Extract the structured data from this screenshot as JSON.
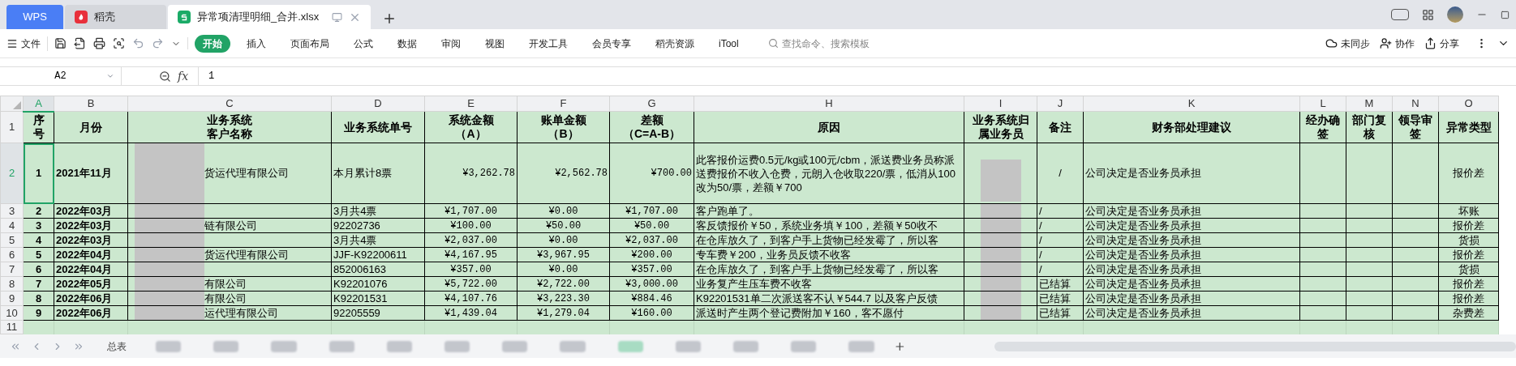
{
  "tabs": [
    {
      "label": "WPS",
      "kind": "wps",
      "selected": false
    },
    {
      "label": "稻壳",
      "kind": "docer",
      "selected": false
    },
    {
      "label": "异常项清理明细_合并.xlsx",
      "kind": "sheet",
      "selected": true
    }
  ],
  "menu": {
    "file": "文件",
    "ribbon_tabs": [
      {
        "label": "开始",
        "selected": true
      },
      {
        "label": "插入",
        "selected": false
      },
      {
        "label": "页面布局",
        "selected": false
      },
      {
        "label": "公式",
        "selected": false
      },
      {
        "label": "数据",
        "selected": false
      },
      {
        "label": "审阅",
        "selected": false
      },
      {
        "label": "视图",
        "selected": false
      },
      {
        "label": "开发工具",
        "selected": false
      },
      {
        "label": "会员专享",
        "selected": false
      },
      {
        "label": "稻壳资源",
        "selected": false
      },
      {
        "label": "iTool",
        "selected": false
      }
    ],
    "search_placeholder": "查找命令、搜索模板",
    "actions": [
      {
        "label": "未同步",
        "kind": "sync"
      },
      {
        "label": "协作",
        "kind": "collab"
      },
      {
        "label": "分享",
        "kind": "share"
      }
    ]
  },
  "formula_bar": {
    "cell": "A2",
    "fx": "fx",
    "value": "1"
  },
  "sheet": {
    "columns": [
      {
        "label": "A",
        "selected": true
      },
      {
        "label": "B",
        "selected": false
      },
      {
        "label": "C",
        "selected": false
      },
      {
        "label": "D",
        "selected": false
      },
      {
        "label": "E",
        "selected": false
      },
      {
        "label": "F",
        "selected": false
      },
      {
        "label": "G",
        "selected": false
      },
      {
        "label": "H",
        "selected": false
      },
      {
        "label": "I",
        "selected": false
      },
      {
        "label": "J",
        "selected": false
      },
      {
        "label": "K",
        "selected": false
      },
      {
        "label": "L",
        "selected": false
      },
      {
        "label": "M",
        "selected": false
      },
      {
        "label": "N",
        "selected": false
      },
      {
        "label": "O",
        "selected": false
      }
    ],
    "header_row": {
      "number": "1",
      "cells": [
        [
          "序",
          "号"
        ],
        [
          "月份"
        ],
        [
          "业务系统",
          "客户名称"
        ],
        [
          "业务系统单号"
        ],
        [
          "系统金额",
          "（A）"
        ],
        [
          "账单金额",
          "（B）"
        ],
        [
          "差额",
          "（C=A-B）"
        ],
        [
          "原因"
        ],
        [
          "业务系统归",
          "属业务员"
        ],
        [
          "备注"
        ],
        [
          "财务部处理建议"
        ],
        [
          "经办确",
          "签"
        ],
        [
          "部门复",
          "核"
        ],
        [
          "领导审",
          "签"
        ],
        [
          "异常类型"
        ]
      ]
    },
    "rows": [
      {
        "number": "2",
        "selected": true,
        "seq": "1",
        "month": "2021年11月",
        "customer": "货运代理有限公司",
        "order_no": "本月累计8票",
        "system_amount": "¥3,262.78",
        "bill_amount": "¥2,562.78",
        "difference": "¥700.00",
        "reason": "此客报价运费0.5元/kg或100元/cbm，派送费业务员称派送费报价不收入仓费，元朗入仓收取220/票，低消从100改为50/票，差额￥700",
        "remark": "/",
        "suggestion": "公司决定是否业务员承担",
        "type": "报价差"
      },
      {
        "number": "3",
        "selected": false,
        "seq": "2",
        "month": "2022年03月",
        "order_no": "3月共4票",
        "system_amount": "¥1,707.00",
        "bill_amount": "¥0.00",
        "difference": "¥1,707.00",
        "reason": "客户跑单了。",
        "remark": "/",
        "suggestion": "公司决定是否业务员承担",
        "type": "坏账"
      },
      {
        "number": "4",
        "selected": false,
        "seq": "3",
        "month": "2022年03月",
        "customer": "链有限公司",
        "order_no": "92202736",
        "system_amount": "¥100.00",
        "bill_amount": "¥50.00",
        "difference": "¥50.00",
        "reason": "客反馈报价￥50，系统业务填￥100，差额￥50收不",
        "remark": "/",
        "suggestion": "公司决定是否业务员承担",
        "type": "报价差"
      },
      {
        "number": "5",
        "selected": false,
        "seq": "4",
        "month": "2022年03月",
        "order_no": "3月共4票",
        "system_amount": "¥2,037.00",
        "bill_amount": "¥0.00",
        "difference": "¥2,037.00",
        "reason": "在仓库放久了，到客户手上货物已经发霉了，所以客",
        "remark": "/",
        "suggestion": "公司决定是否业务员承担",
        "type": "货损"
      },
      {
        "number": "6",
        "selected": false,
        "seq": "5",
        "month": "2022年04月",
        "customer": "货运代理有限公司",
        "order_no": "JJF-K92200611",
        "system_amount": "¥4,167.95",
        "bill_amount": "¥3,967.95",
        "difference": "¥200.00",
        "reason": "专车费￥200，业务员反馈不收客",
        "remark": "/",
        "suggestion": "公司决定是否业务员承担",
        "type": "报价差"
      },
      {
        "number": "7",
        "selected": false,
        "seq": "6",
        "month": "2022年04月",
        "order_no": "852006163",
        "system_amount": "¥357.00",
        "bill_amount": "¥0.00",
        "difference": "¥357.00",
        "reason": "在仓库放久了，到客户手上货物已经发霉了，所以客",
        "remark": "/",
        "suggestion": "公司决定是否业务员承担",
        "type": "货损"
      },
      {
        "number": "8",
        "selected": false,
        "seq": "7",
        "month": "2022年05月",
        "customer": "有限公司",
        "order_no": "K92201076",
        "system_amount": "¥5,722.00",
        "bill_amount": "¥2,722.00",
        "difference": "¥3,000.00",
        "reason": "业务复产生压车费不收客",
        "remark": "已结算",
        "suggestion": "公司决定是否业务员承担",
        "type": "报价差"
      },
      {
        "number": "9",
        "selected": false,
        "seq": "8",
        "month": "2022年06月",
        "customer": "有限公司",
        "order_no": "K92201531",
        "system_amount": "¥4,107.76",
        "bill_amount": "¥3,223.30",
        "difference": "¥884.46",
        "reason": "K92201531单二次派送客不认￥544.7 以及客户反馈",
        "remark": "已结算",
        "suggestion": "公司决定是否业务员承担",
        "type": "报价差"
      },
      {
        "number": "10",
        "selected": false,
        "seq": "9",
        "month": "2022年06月",
        "customer": "运代理有限公司",
        "order_no": "92205559",
        "system_amount": "¥1,439.04",
        "bill_amount": "¥1,279.04",
        "difference": "¥160.00",
        "reason": "派送时产生两个登记费附加￥160，客不愿付",
        "remark": "已结算",
        "suggestion": "公司决定是否业务员承担",
        "type": "杂费差"
      }
    ],
    "empty_row": "11"
  },
  "sheet_tabs": [
    {
      "label": "总表"
    }
  ],
  "blurred_tabs": [
    {
      "selected": false
    },
    {
      "selected": false
    },
    {
      "selected": false
    },
    {
      "selected": false
    },
    {
      "selected": false
    },
    {
      "selected": false
    },
    {
      "selected": false
    },
    {
      "selected": false
    },
    {
      "selected": true
    },
    {
      "selected": false
    },
    {
      "selected": false
    },
    {
      "selected": false
    },
    {
      "selected": false
    }
  ]
}
